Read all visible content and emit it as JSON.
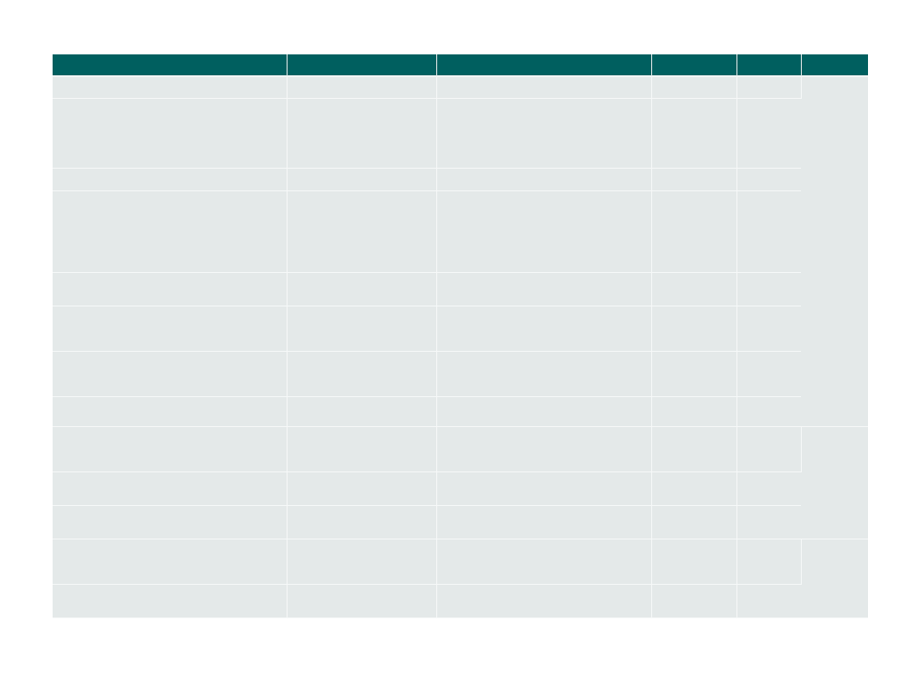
{
  "table": {
    "headers": [
      "",
      "",
      "",
      "",
      "",
      ""
    ],
    "rows": [
      [
        "",
        "",
        "",
        "",
        ""
      ],
      [
        "",
        "",
        "",
        "",
        ""
      ],
      [
        "",
        "",
        "",
        "",
        ""
      ],
      [
        "",
        "",
        "",
        "",
        ""
      ],
      [
        "",
        "",
        "",
        "",
        ""
      ],
      [
        "",
        "",
        "",
        "",
        ""
      ],
      [
        "",
        "",
        "",
        "",
        ""
      ],
      [
        "",
        "",
        "",
        "",
        ""
      ],
      [
        "",
        "",
        "",
        "",
        ""
      ],
      [
        "",
        "",
        "",
        "",
        ""
      ],
      [
        "",
        "",
        "",
        "",
        ""
      ],
      [
        "",
        "",
        "",
        "",
        ""
      ],
      [
        "",
        "",
        "",
        "",
        ""
      ]
    ],
    "group_cells": [
      "",
      "",
      ""
    ]
  }
}
